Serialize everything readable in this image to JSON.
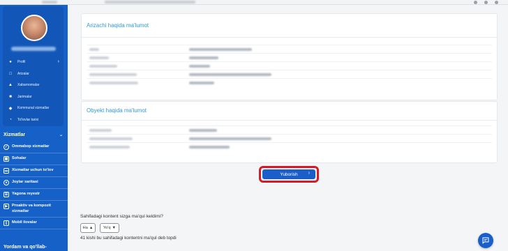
{
  "profile": {
    "menu": [
      {
        "label": "Profil",
        "icon": "user-icon",
        "has_chevron": true
      },
      {
        "label": "Arizalar",
        "icon": "document-icon",
        "has_chevron": false
      },
      {
        "label": "Xabarnomalar",
        "icon": "bell-icon",
        "has_chevron": false
      },
      {
        "label": "Jarimalar",
        "icon": "fine-icon",
        "has_chevron": false
      },
      {
        "label": "Kommunal xizmatlar",
        "icon": "utility-icon",
        "has_chevron": false
      },
      {
        "label": "To'lovlar tarixi",
        "icon": "history-icon",
        "has_chevron": false
      }
    ]
  },
  "sidebar": {
    "section_title": "Xizmatlar",
    "items": [
      {
        "label": "Ommabop xizmatlar",
        "icon": "star-icon"
      },
      {
        "label": "Sohalar",
        "icon": "grid-icon"
      },
      {
        "label": "Xizmatlar uchun to'lov",
        "icon": "payment-icon"
      },
      {
        "label": "Joylar xaritasi",
        "icon": "map-icon"
      },
      {
        "label": "Yagona reyestr",
        "icon": "registry-icon"
      },
      {
        "label": "Proaktiv va kompozit xizmatlar",
        "icon": "proactive-icon"
      },
      {
        "label": "Mobil ilovalar",
        "icon": "mobile-icon"
      }
    ],
    "help_title": "Yordam va qo'llab-"
  },
  "applicant_panel": {
    "title": "Arizachi haqida ma'lumot"
  },
  "object_panel": {
    "title": "Obyekt haqida ma'lumot"
  },
  "submit": {
    "label": "Yuborish"
  },
  "feedback": {
    "question": "Sahifadagi kontent sizga ma'qul keldimi?",
    "yes": "Ha",
    "no": "Yo'q",
    "count_text": "41 kishi bu sahifadagi kontentni ma'qul deb topdi"
  },
  "colors": {
    "sidebar": "#1661c8",
    "accent": "#2f9ad6",
    "button": "#1a5fc9",
    "highlight": "#d61a27"
  }
}
